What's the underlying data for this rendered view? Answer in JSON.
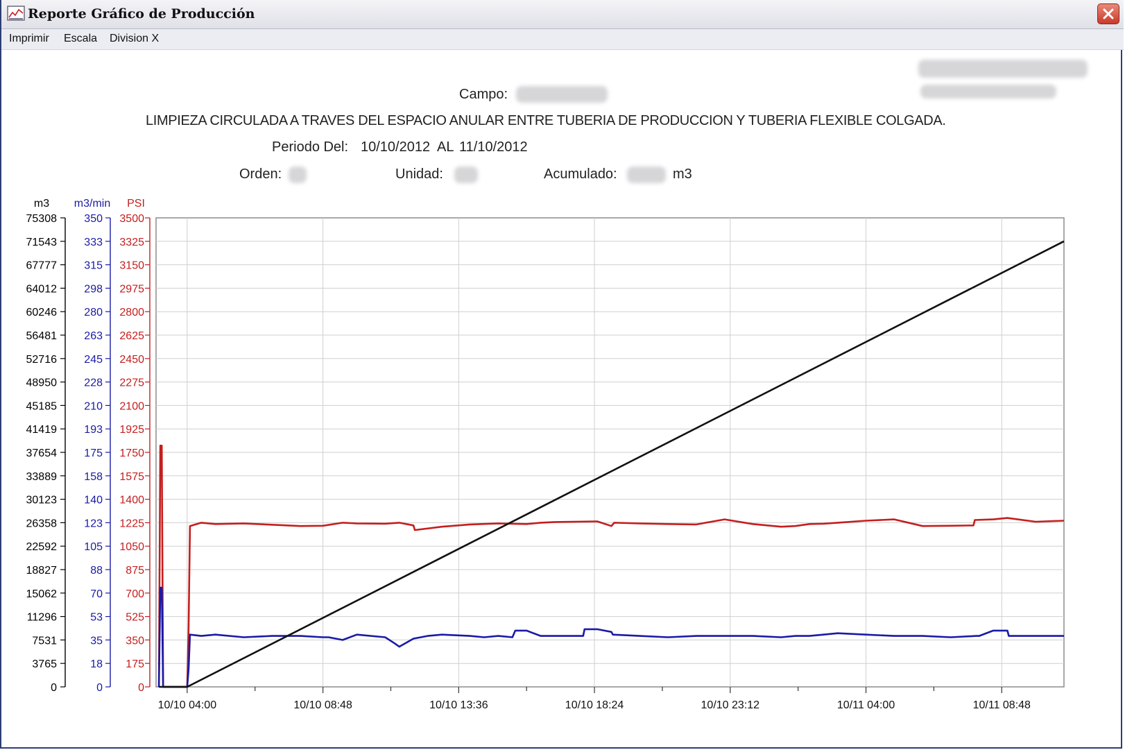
{
  "window": {
    "title": "Reporte Gráfico de Producción"
  },
  "menu": {
    "items": [
      "Imprimir",
      "Escala",
      "Division X"
    ]
  },
  "header": {
    "campo_label": "Campo:",
    "description": "LIMPIEZA CIRCULADA A TRAVES DEL ESPACIO ANULAR ENTRE TUBERIA DE PRODUCCION Y TUBERIA FLEXIBLE COLGADA.",
    "periodo_label": "Periodo Del:",
    "periodo_from": "10/10/2012",
    "periodo_to_label": "AL",
    "periodo_to": "11/10/2012",
    "orden_label": "Orden:",
    "unidad_label": "Unidad:",
    "acumulado_label": "Acumulado:",
    "acumulado_unit": "m3"
  },
  "chart_data": {
    "type": "line",
    "grid": true,
    "axes": {
      "m3": {
        "label": "m3",
        "color": "#000000",
        "ticks": [
          "0",
          "3765",
          "7531",
          "11296",
          "15062",
          "18827",
          "22592",
          "26358",
          "30123",
          "33889",
          "37654",
          "41419",
          "45185",
          "48950",
          "52716",
          "56481",
          "60246",
          "64012",
          "67777",
          "71543",
          "75308"
        ],
        "range": [
          0,
          75308
        ]
      },
      "flow": {
        "label": "m3/min",
        "color": "#1a1aa6",
        "ticks": [
          "0",
          "18",
          "35",
          "53",
          "70",
          "88",
          "105",
          "123",
          "140",
          "158",
          "175",
          "193",
          "210",
          "228",
          "245",
          "263",
          "280",
          "298",
          "315",
          "333",
          "350"
        ],
        "range": [
          0,
          350
        ]
      },
      "pressure": {
        "label": "PSI",
        "color": "#c41e1e",
        "ticks": [
          "0",
          "175",
          "350",
          "525",
          "700",
          "875",
          "1050",
          "1225",
          "1400",
          "1575",
          "1750",
          "1925",
          "2100",
          "2275",
          "2450",
          "2625",
          "2800",
          "2975",
          "3150",
          "3325",
          "3500"
        ],
        "range": [
          0,
          3500
        ]
      }
    },
    "x_ticks": [
      "10/10 04:00",
      "10/10 08:48",
      "10/10 13:36",
      "10/10 18:24",
      "10/10 23:12",
      "10/11 04:00",
      "10/11 08:48"
    ],
    "x_range_hours": [
      -1.1,
      31.0
    ],
    "series": [
      {
        "axis": "pressure",
        "color": "#c41e1e",
        "x": [
          -1.0,
          -0.95,
          -0.9,
          -0.85,
          0.0,
          0.05,
          0.1,
          0.5,
          1.0,
          2.0,
          3.0,
          4.0,
          4.8,
          5.5,
          6.0,
          7.0,
          7.5,
          8.0,
          8.05,
          9.0,
          10.0,
          11.0,
          12.0,
          12.5,
          13.0,
          14.5,
          15.0,
          15.1,
          16.0,
          17.0,
          18.0,
          19.0,
          20.0,
          21.0,
          21.5,
          22.0,
          22.5,
          23.0,
          24.0,
          25.0,
          26.0,
          27.0,
          27.8,
          27.85,
          28.5,
          29.0,
          30.0,
          31.0
        ],
        "y": [
          0,
          1800,
          1800,
          0,
          0,
          430,
          1200,
          1225,
          1215,
          1220,
          1210,
          1200,
          1202,
          1225,
          1220,
          1218,
          1225,
          1205,
          1170,
          1195,
          1212,
          1220,
          1215,
          1225,
          1230,
          1235,
          1200,
          1225,
          1220,
          1215,
          1212,
          1250,
          1215,
          1195,
          1200,
          1215,
          1218,
          1225,
          1240,
          1250,
          1200,
          1202,
          1205,
          1245,
          1250,
          1260,
          1232,
          1240
        ]
      },
      {
        "axis": "flow",
        "color": "#1a1aa6",
        "x": [
          -1.0,
          -0.95,
          -0.9,
          -0.85,
          0.0,
          0.05,
          0.1,
          0.5,
          1.0,
          2.0,
          3.0,
          4.0,
          4.8,
          5.0,
          5.5,
          6.0,
          7.0,
          7.3,
          7.5,
          8.0,
          8.5,
          9.0,
          10.0,
          10.5,
          11.0,
          11.5,
          11.6,
          12.0,
          12.5,
          14.0,
          14.05,
          14.5,
          15.0,
          15.05,
          16.0,
          17.0,
          18.0,
          19.0,
          20.0,
          21.0,
          21.5,
          22.0,
          22.5,
          23.0,
          24.0,
          25.0,
          26.0,
          27.0,
          27.9,
          28.0,
          28.5,
          29.0,
          29.05,
          30.0,
          31.0
        ],
        "y": [
          0,
          74,
          74,
          0,
          0,
          13,
          39,
          38,
          39,
          37,
          38,
          38,
          37,
          37,
          35,
          39,
          37,
          33,
          30,
          36,
          38,
          39,
          38,
          37,
          38,
          37,
          42,
          42,
          38,
          38,
          43,
          43,
          41,
          39,
          38,
          37,
          38,
          38,
          38,
          37,
          38,
          38,
          39,
          40,
          39,
          38,
          38,
          37,
          38,
          38,
          42,
          42,
          38,
          38,
          38
        ]
      },
      {
        "axis": "m3",
        "color": "#111111",
        "x": [
          -1.0,
          0.0,
          31.0
        ],
        "y": [
          0,
          0,
          71543
        ]
      }
    ]
  }
}
